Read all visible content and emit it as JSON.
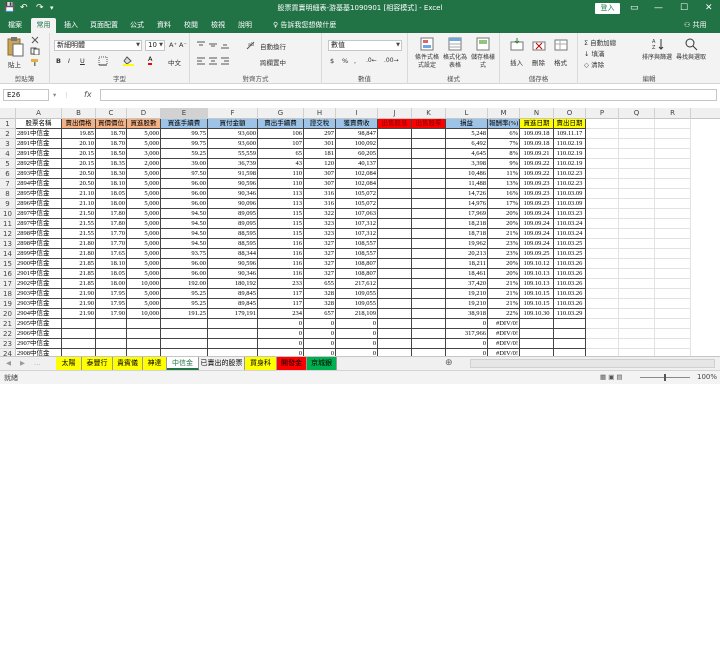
{
  "window": {
    "title": "股票買賣明細表-游基基1090901 [相容模式] - Excel",
    "login": "登入"
  },
  "qa": {
    "save": "💾",
    "undo": "↶",
    "redo": "↷",
    "more": "▾"
  },
  "win": {
    "ribbonopt": "▭",
    "min": "—",
    "max": "☐",
    "close": "✕"
  },
  "tabs": [
    "檔案",
    "常用",
    "插入",
    "頁面配置",
    "公式",
    "資料",
    "校閱",
    "檢視",
    "說明"
  ],
  "active_tab": "常用",
  "tell_me": "♀ 告訴我您想做什麼",
  "share": "⚇ 共用",
  "ribbon": {
    "clipboard": {
      "label": "剪貼簿",
      "paste": "貼上"
    },
    "font": {
      "label": "字型",
      "name": "新細明體",
      "size": "10",
      "grow": "A⁺",
      "shrink": "A⁻",
      "bold": "B",
      "italic": "I",
      "underline": "U",
      "color_a": "A",
      "phonetic": "中文"
    },
    "align": {
      "label": "對齊方式",
      "wrap": "自動換行",
      "merge": "跨欄置中"
    },
    "number": {
      "label": "數值",
      "format": "數值",
      "currency": "$",
      "percent": "%",
      "comma": ",",
      "inc": ".0←",
      "dec": ".00→"
    },
    "styles": {
      "label": "樣式",
      "cond": "條件式格式設定",
      "table": "格式化為表格",
      "cell": "儲存格樣式"
    },
    "cells": {
      "label": "儲存格",
      "insert": "插入",
      "delete": "刪除",
      "format": "格式"
    },
    "editing": {
      "label": "編輯",
      "autosum": "Σ 自動加總",
      "fill": "↓ 填滿",
      "clear": "◇ 清除",
      "sort": "排序與篩選",
      "find": "尋找與選取"
    }
  },
  "formula_bar": {
    "name_box": "E26",
    "fx": "fx",
    "content": ""
  },
  "columns": [
    "A",
    "B",
    "C",
    "D",
    "E",
    "F",
    "G",
    "H",
    "I",
    "J",
    "K",
    "L",
    "M",
    "N",
    "O",
    "P",
    "Q",
    "R"
  ],
  "headers": [
    "股票名稱",
    "賣出價格",
    "買價價位",
    "買進股數",
    "買進手續費",
    "買付金額",
    "賣出手續費",
    "證交稅",
    "獲賣費收",
    "出售股息",
    "出售股票",
    "損益",
    "報酬率(%)",
    "買進日期",
    "賣出日期"
  ],
  "rows": [
    [
      "2891中信金",
      "19.85",
      "18.70",
      "5,000",
      "99.75",
      "93,600",
      "106",
      "297",
      "98,847",
      "",
      "",
      "5,248",
      "6%",
      "109.09.18",
      "109.11.17"
    ],
    [
      "2891中信金",
      "20.10",
      "18.70",
      "5,000",
      "99.75",
      "93,600",
      "107",
      "301",
      "100,092",
      "",
      "",
      "6,492",
      "7%",
      "109.09.18",
      "110.02.19"
    ],
    [
      "2891中信金",
      "20.15",
      "18.50",
      "3,000",
      "59.25",
      "55,559",
      "65",
      "181",
      "60,205",
      "",
      "",
      "4,645",
      "8%",
      "109.09.21",
      "110.02.19"
    ],
    [
      "2892中信金",
      "20.15",
      "18.35",
      "2,000",
      "39.00",
      "36,739",
      "43",
      "120",
      "40,137",
      "",
      "",
      "3,398",
      "9%",
      "109.09.22",
      "110.02.19"
    ],
    [
      "2893中信金",
      "20.50",
      "18.30",
      "5,000",
      "97.50",
      "91,598",
      "110",
      "307",
      "102,084",
      "",
      "",
      "10,486",
      "11%",
      "109.09.22",
      "110.02.23"
    ],
    [
      "2894中信金",
      "20.50",
      "18.10",
      "5,000",
      "96.00",
      "90,596",
      "110",
      "307",
      "102,084",
      "",
      "",
      "11,488",
      "13%",
      "109.09.23",
      "110.02.23"
    ],
    [
      "2895中信金",
      "21.10",
      "18.05",
      "5,000",
      "96.00",
      "90,346",
      "113",
      "316",
      "105,072",
      "",
      "",
      "14,726",
      "16%",
      "109.09.23",
      "110.03.09"
    ],
    [
      "2896中信金",
      "21.10",
      "18.00",
      "5,000",
      "96.00",
      "90,096",
      "113",
      "316",
      "105,072",
      "",
      "",
      "14,976",
      "17%",
      "109.09.23",
      "110.03.09"
    ],
    [
      "2897中信金",
      "21.50",
      "17.80",
      "5,000",
      "94.50",
      "89,095",
      "115",
      "322",
      "107,063",
      "",
      "",
      "17,969",
      "20%",
      "109.09.24",
      "110.03.23"
    ],
    [
      "2897中信金",
      "21.55",
      "17.80",
      "5,000",
      "94.50",
      "89,095",
      "115",
      "323",
      "107,312",
      "",
      "",
      "18,218",
      "20%",
      "109.09.24",
      "110.03.24"
    ],
    [
      "2898中信金",
      "21.55",
      "17.70",
      "5,000",
      "94.50",
      "88,595",
      "115",
      "323",
      "107,312",
      "",
      "",
      "18,718",
      "21%",
      "109.09.24",
      "110.03.24"
    ],
    [
      "2898中信金",
      "21.80",
      "17.70",
      "5,000",
      "94.50",
      "88,595",
      "116",
      "327",
      "108,557",
      "",
      "",
      "19,962",
      "23%",
      "109.09.24",
      "110.03.25"
    ],
    [
      "2899中信金",
      "21.80",
      "17.65",
      "5,000",
      "93.75",
      "88,344",
      "116",
      "327",
      "108,557",
      "",
      "",
      "20,213",
      "23%",
      "109.09.25",
      "110.03.25"
    ],
    [
      "2900中信金",
      "21.85",
      "18.10",
      "5,000",
      "96.00",
      "90,596",
      "116",
      "327",
      "108,807",
      "",
      "",
      "18,211",
      "20%",
      "109.10.12",
      "110.03.26"
    ],
    [
      "2901中信金",
      "21.85",
      "18.05",
      "5,000",
      "96.00",
      "90,346",
      "116",
      "327",
      "108,807",
      "",
      "",
      "18,461",
      "20%",
      "109.10.13",
      "110.03.26"
    ],
    [
      "2902中信金",
      "21.85",
      "18.00",
      "10,000",
      "192.00",
      "180,192",
      "233",
      "655",
      "217,612",
      "",
      "",
      "37,420",
      "21%",
      "109.10.13",
      "110.03.26"
    ],
    [
      "2903中信金",
      "21.90",
      "17.95",
      "5,000",
      "95.25",
      "89,845",
      "117",
      "328",
      "109,055",
      "",
      "",
      "19,210",
      "21%",
      "109.10.15",
      "110.03.26"
    ],
    [
      "2903中信金",
      "21.90",
      "17.95",
      "5,000",
      "95.25",
      "89,845",
      "117",
      "328",
      "109,055",
      "",
      "",
      "19,210",
      "21%",
      "109.10.15",
      "110.03.26"
    ],
    [
      "2904中信金",
      "21.90",
      "17.90",
      "10,000",
      "191.25",
      "179,191",
      "234",
      "657",
      "218,109",
      "",
      "",
      "38,918",
      "22%",
      "109.10.30",
      "110.03.29"
    ],
    [
      "2905中信金",
      "",
      "",
      "",
      "",
      "",
      "0",
      "0",
      "0",
      "",
      "",
      "0",
      "#DIV/0!",
      "",
      ""
    ],
    [
      "2906中信金",
      "",
      "",
      "",
      "",
      "",
      "0",
      "0",
      "0",
      "",
      "",
      "317,966",
      "#DIV/0!",
      "",
      ""
    ],
    [
      "2907中信金",
      "",
      "",
      "",
      "",
      "",
      "0",
      "0",
      "0",
      "",
      "",
      "0",
      "#DIV/0!",
      "",
      ""
    ],
    [
      "2908中信金",
      "",
      "",
      "",
      "",
      "",
      "0",
      "0",
      "0",
      "",
      "",
      "0",
      "#DIV/0!",
      "",
      ""
    ]
  ],
  "sheets": [
    {
      "name": "太陽",
      "color": "#ffff00"
    },
    {
      "name": "泰豐行",
      "color": "#ffff00"
    },
    {
      "name": "貴賓儀",
      "color": "#ffff00"
    },
    {
      "name": "神達",
      "color": "#ffff00"
    },
    {
      "name": "中信金",
      "color": "#ffffff",
      "active": true
    },
    {
      "name": "已賣出的股票",
      "color": "#f0f0f0"
    },
    {
      "name": "買身科",
      "color": "#ffff00"
    },
    {
      "name": "開發金",
      "color": "#ff0000"
    },
    {
      "name": "京城銀",
      "color": "#00b050"
    }
  ],
  "status": {
    "ready": "就緒",
    "zoom": "100%"
  },
  "colors": {
    "excel_green": "#217346",
    "header_blue": "#9dc3e6",
    "header_orange": "#f4b183",
    "header_red": "#ff0000",
    "header_yellow": "#ffff00",
    "header_green": "#c6e0b4"
  }
}
